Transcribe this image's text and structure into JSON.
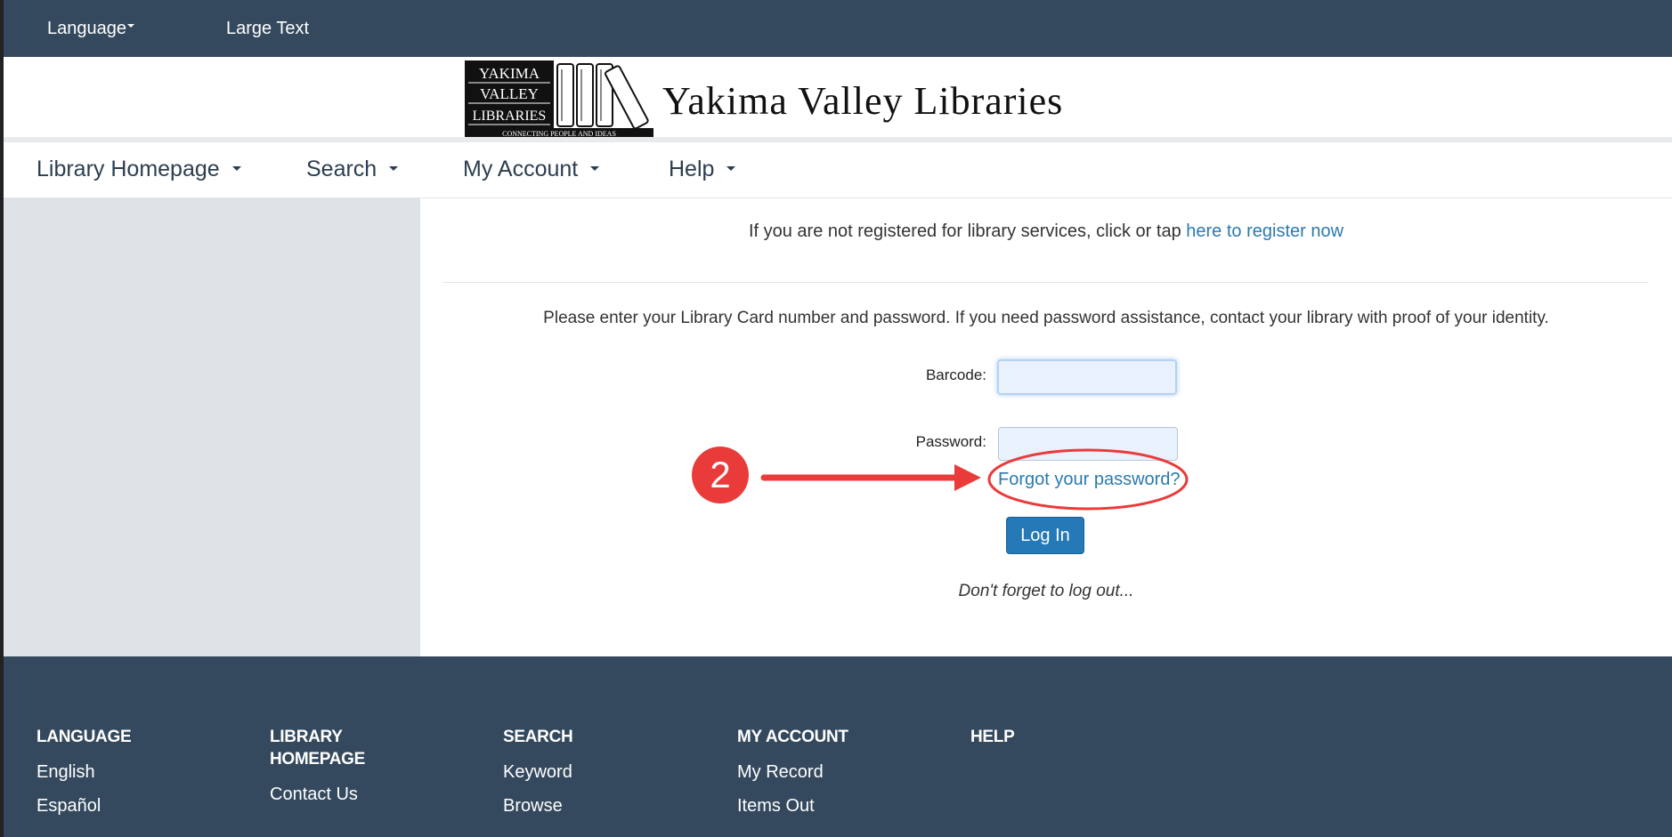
{
  "topbar": {
    "language_label": "Language",
    "large_text_label": "Large Text"
  },
  "logo": {
    "mark_words": [
      "YAKIMA",
      "VALLEY",
      "LIBRARIES"
    ],
    "tagline": "CONNECTING PEOPLE AND IDEAS",
    "title": "Yakima Valley Libraries"
  },
  "nav": {
    "items": [
      {
        "label": "Library Homepage"
      },
      {
        "label": "Search"
      },
      {
        "label": "My Account"
      },
      {
        "label": "Help"
      }
    ]
  },
  "main": {
    "register_text": "If you are not registered for library services, click or tap ",
    "register_link": "here to register now",
    "instructions": "Please enter your Library Card number and password. If you need password assistance, contact your library with proof of your identity.",
    "barcode_label": "Barcode:",
    "barcode_value": "",
    "password_label": "Password:",
    "password_value": "",
    "forgot_link": "Forgot your password?",
    "login_button": "Log In",
    "logout_note": "Don't forget to log out..."
  },
  "annotation": {
    "step": "2",
    "color": "#ea3b3b"
  },
  "footer": {
    "columns": [
      {
        "heading": "LANGUAGE",
        "links": [
          "English",
          "Español"
        ]
      },
      {
        "heading": "LIBRARY HOMEPAGE",
        "links": [
          "Contact Us"
        ]
      },
      {
        "heading": "SEARCH",
        "links": [
          "Keyword",
          "Browse"
        ]
      },
      {
        "heading": "MY ACCOUNT",
        "links": [
          "My Record",
          "Items Out"
        ]
      },
      {
        "heading": "HELP",
        "links": []
      }
    ]
  },
  "colors": {
    "header_bg": "#34495e",
    "sidebar_bg": "#dfe3e7",
    "link": "#2a7ab0",
    "button": "#2579b6"
  }
}
